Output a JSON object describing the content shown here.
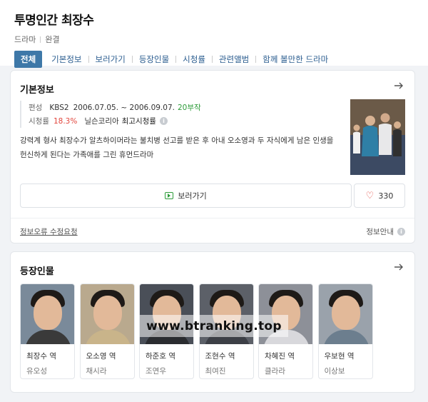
{
  "header": {
    "title": "투명인간 최장수",
    "genre": "드라마",
    "status": "완결",
    "tabs": [
      "전체",
      "기본정보",
      "보러가기",
      "등장인물",
      "시청률",
      "관련앨범",
      "함께 볼만한 드라마"
    ]
  },
  "basic_info": {
    "section_title": "기본정보",
    "broadcast_label": "편성",
    "channel": "KBS2",
    "period": "2006.07.05. ~ 2006.09.07.",
    "episodes": "20부작",
    "rating_label": "시청률",
    "rating": "18.3%",
    "rating_source": "닐슨코리아",
    "rating_type": "최고시청률",
    "description": "강력계 형사 최장수가 알츠하이머라는 불치병 선고를 받은 후 아내 오소영과 두 자식에게 남은 인생을 헌신하게 된다는 가족애를 그린 휴먼드라마",
    "watch_label": "보러가기",
    "like_count": "330",
    "report_label": "정보오류 수정요청",
    "guide_label": "정보안내"
  },
  "cast": {
    "section_title": "등장인물",
    "members": [
      {
        "role": "최장수 역",
        "actor": "유오성",
        "bg": "#7a8a9a",
        "shirt": "#3a3a3a"
      },
      {
        "role": "오소영 역",
        "actor": "채시라",
        "bg": "#b9a98e",
        "shirt": "#c9b48a"
      },
      {
        "role": "하준호 역",
        "actor": "조연우",
        "bg": "#4a4f58",
        "shirt": "#2a2c30"
      },
      {
        "role": "조현수 역",
        "actor": "최여진",
        "bg": "#5c6068",
        "shirt": "#3c3f46"
      },
      {
        "role": "차혜진 역",
        "actor": "클라라",
        "bg": "#8d9098",
        "shirt": "#d8d8dc"
      },
      {
        "role": "우보현 역",
        "actor": "이상보",
        "bg": "#9aa2ab",
        "shirt": "#6c7e8e"
      }
    ]
  },
  "watermark": "www.btranking.top"
}
